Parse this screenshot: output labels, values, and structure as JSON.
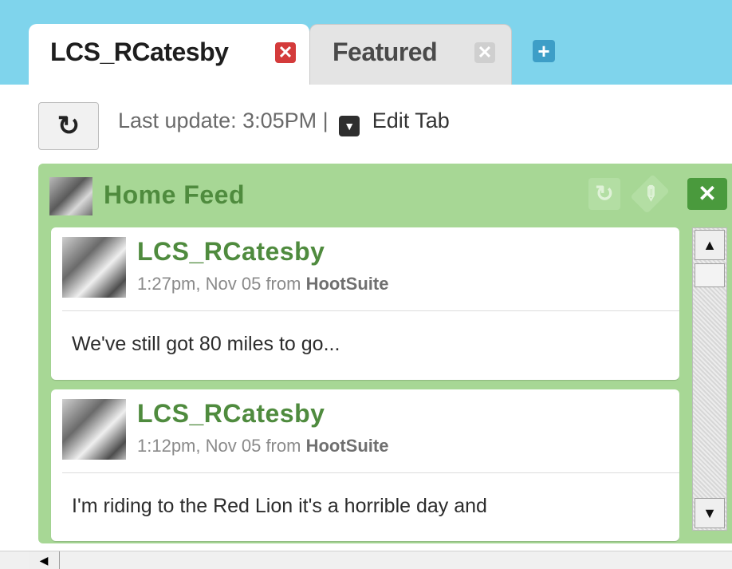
{
  "tabs": [
    {
      "label": "LCS_RCatesby",
      "close": "✕",
      "active": true
    },
    {
      "label": "Featured",
      "close": "✕",
      "active": false
    }
  ],
  "add_tab_label": "+",
  "toolbar": {
    "refresh_icon": "refresh-icon",
    "last_update": "Last update: 3:05PM |",
    "edit_tab": "Edit Tab"
  },
  "column": {
    "title": "Home Feed",
    "controls": {
      "refresh": "↻",
      "edit": "✎",
      "close": "✕"
    }
  },
  "messages": [
    {
      "author": "LCS_RCatesby",
      "time": "1:27pm, Nov 05",
      "from_word": "from",
      "source": "HootSuite",
      "text": "We've still got 80 miles to go..."
    },
    {
      "author": "LCS_RCatesby",
      "time": "1:12pm, Nov 05",
      "from_word": "from",
      "source": "HootSuite",
      "text": "I'm riding to the Red Lion it's a horrible day and"
    }
  ],
  "colors": {
    "topbar": "#7fd4ec",
    "column_bg": "#a7d795",
    "accent_green": "#4f8b3e",
    "tab_close_active": "#d43b3b",
    "add_tab": "#3d9ec7"
  }
}
